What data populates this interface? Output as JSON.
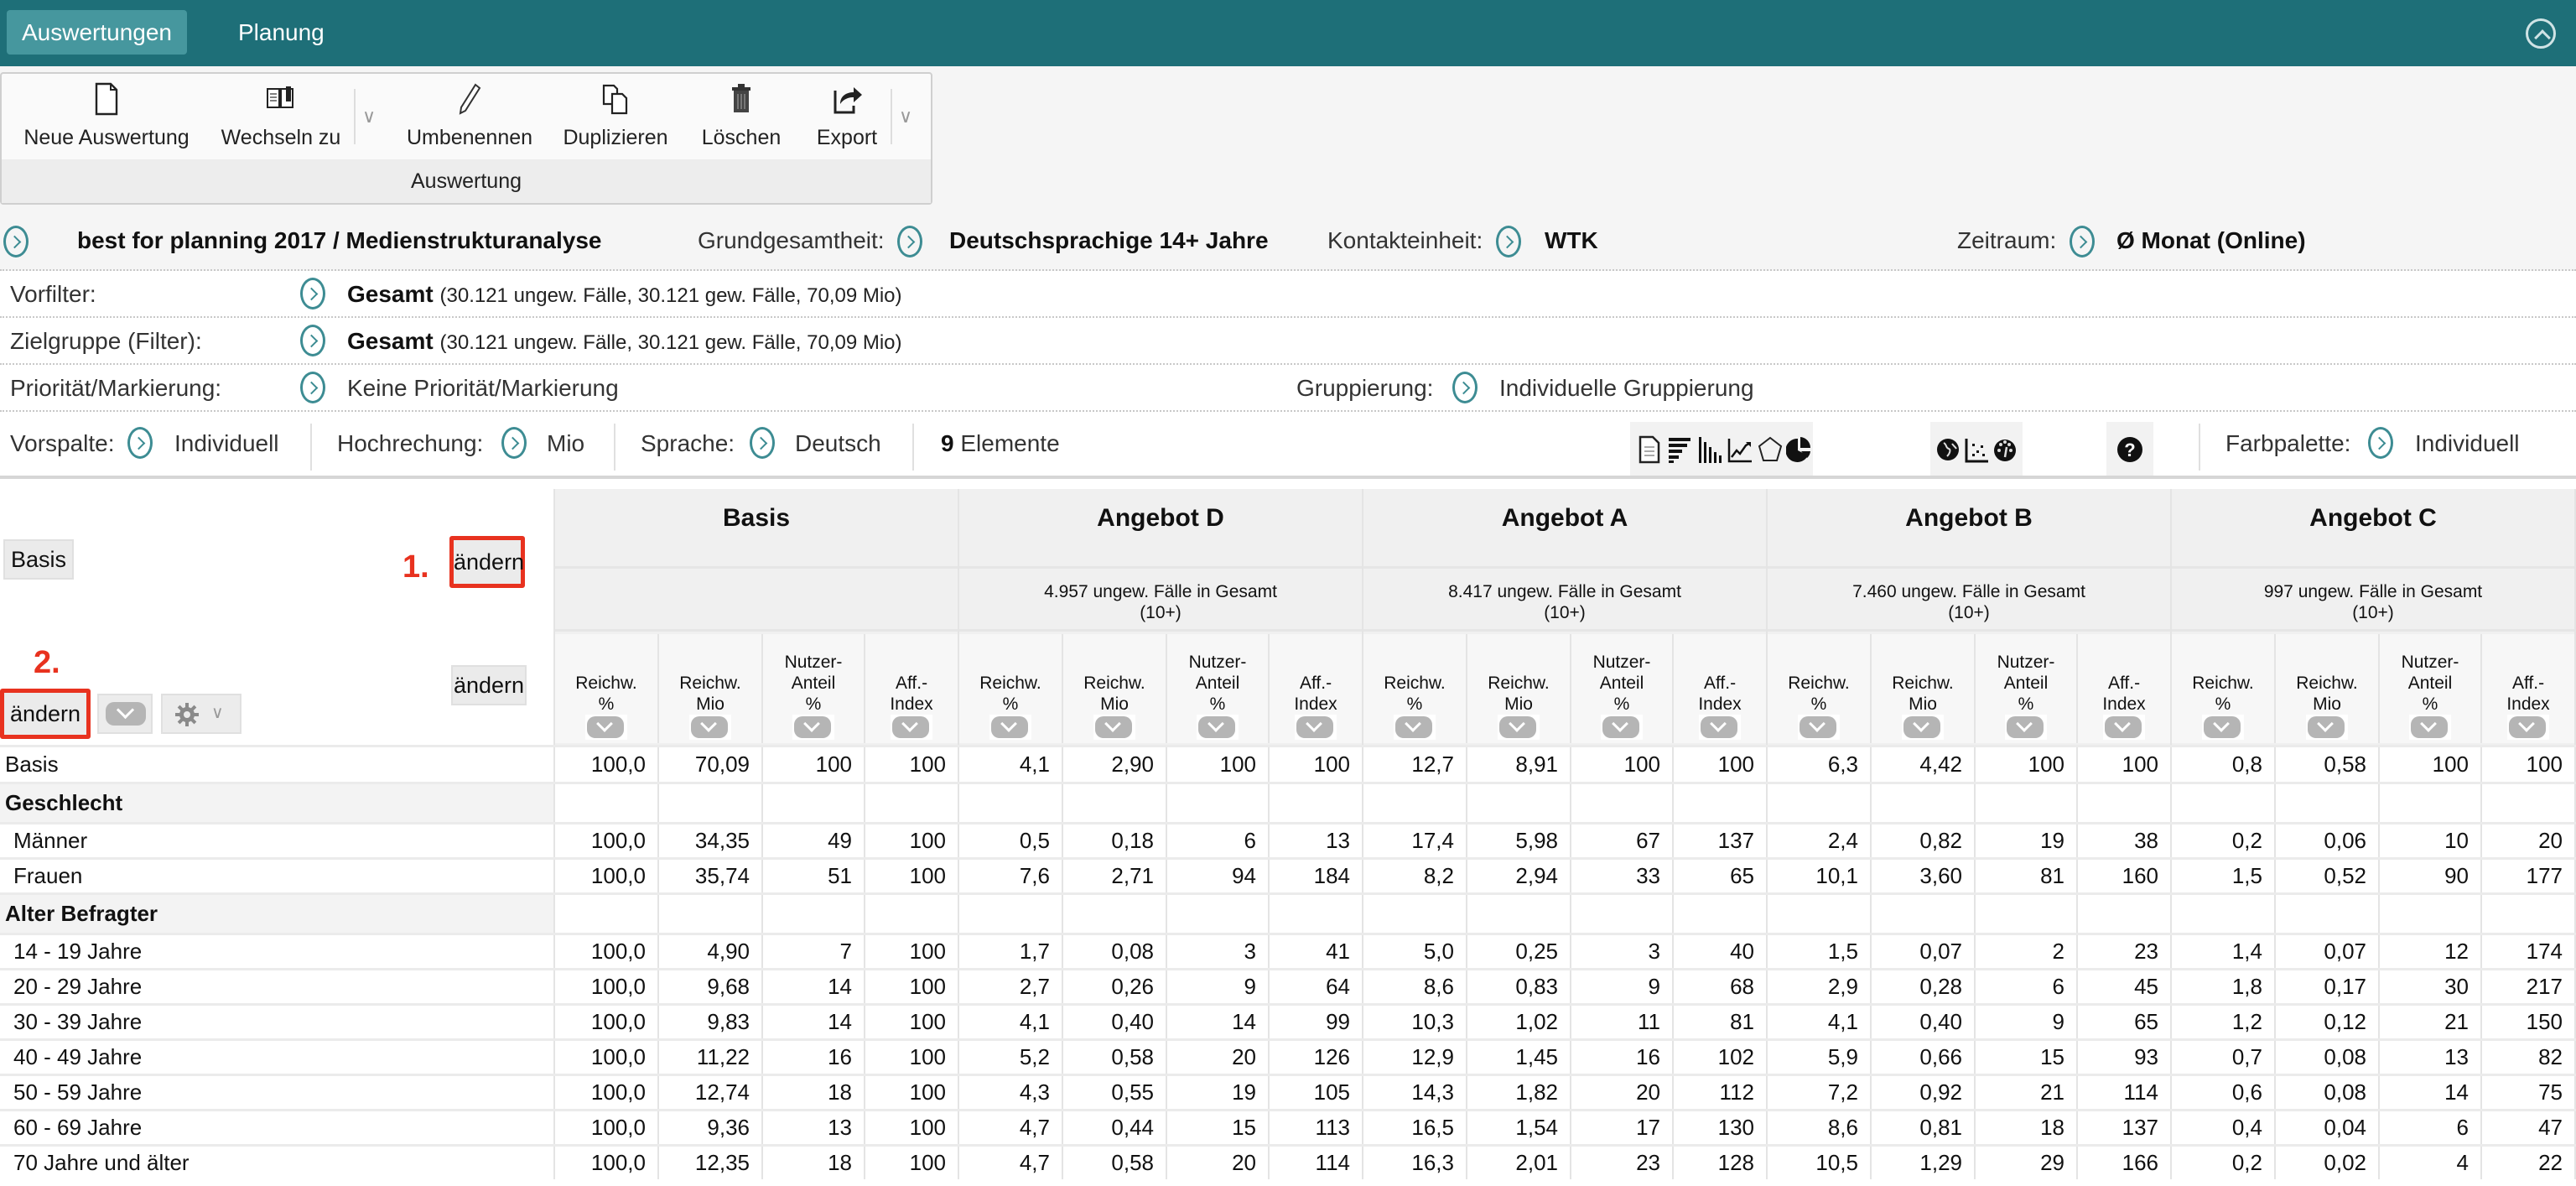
{
  "topbar": {
    "tabs": [
      {
        "label": "Auswertungen",
        "active": true
      },
      {
        "label": "Planung",
        "active": false
      }
    ],
    "collapse_icon": "chevron-up-circle-icon"
  },
  "ribbon": {
    "group_label": "Auswertung",
    "buttons": [
      {
        "label": "Neue Auswertung",
        "icon": "new-document-icon"
      },
      {
        "label": "Wechseln zu",
        "icon": "switch-book-icon"
      },
      {
        "label": "Umbenennen",
        "icon": "pencil-icon"
      },
      {
        "label": "Duplizieren",
        "icon": "duplicate-icon"
      },
      {
        "label": "Löschen",
        "icon": "trash-icon"
      },
      {
        "label": "Export",
        "icon": "export-icon"
      }
    ]
  },
  "study": {
    "title": "best for planning 2017 / Medienstrukturanalyse",
    "grundgesamtheit_label": "Grundgesamtheit:",
    "grundgesamtheit_value": "Deutschsprachige 14+ Jahre",
    "kontakteinheit_label": "Kontakteinheit:",
    "kontakteinheit_value": "WTK",
    "zeitraum_label": "Zeitraum:",
    "zeitraum_value": "Ø Monat (Online)"
  },
  "filters": {
    "vorfilter_label": "Vorfilter:",
    "vorfilter_value": "Gesamt",
    "vorfilter_detail": "(30.121 ungew. Fälle, 30.121 gew. Fälle, 70,09 Mio)",
    "zielgruppe_label": "Zielgruppe (Filter):",
    "zielgruppe_value": "Gesamt",
    "zielgruppe_detail": "(30.121 ungew. Fälle, 30.121 gew. Fälle, 70,09 Mio)",
    "prioritaet_label": "Priorität/Markierung:",
    "prioritaet_value": "Keine Priorität/Markierung",
    "gruppierung_label": "Gruppierung:",
    "gruppierung_value": "Individuelle Gruppierung"
  },
  "options": {
    "vorspalte_label": "Vorspalte:",
    "vorspalte_value": "Individuell",
    "hochrechnung_label": "Hochrechung:",
    "hochrechnung_value": "Mio",
    "sprache_label": "Sprache:",
    "sprache_value": "Deutsch",
    "elemente_count": "9",
    "elemente_label": "Elemente",
    "farbpalette_label": "Farbpalette:",
    "farbpalette_value": "Individuell",
    "view_icons": [
      "table-view-icon",
      "horizontal-bar-chart-icon",
      "vertical-bar-chart-icon",
      "line-chart-icon",
      "radar-chart-icon",
      "pie-chart-icon"
    ],
    "extra_icons": [
      "globe-map-icon",
      "scatter-plot-icon",
      "gauge-icon"
    ],
    "help_icon": "help-icon"
  },
  "table": {
    "corner": {
      "basis_label": "Basis",
      "aendern_label": "ändern",
      "annotation_1": "1.",
      "annotation_2": "2."
    },
    "column_headers": [
      "Reichw.\n%",
      "Reichw.\nMio",
      "Nutzer-\nAnteil\n%",
      "Aff.-\nIndex"
    ],
    "groups": [
      {
        "title": "Basis",
        "subtitle": ""
      },
      {
        "title": "Angebot D",
        "subtitle": "4.957 ungew. Fälle in Gesamt (10+)"
      },
      {
        "title": "Angebot A",
        "subtitle": "8.417 ungew. Fälle in Gesamt (10+)"
      },
      {
        "title": "Angebot B",
        "subtitle": "7.460 ungew. Fälle in Gesamt (10+)"
      },
      {
        "title": "Angebot C",
        "subtitle": "997 ungew. Fälle in Gesamt (10+)"
      }
    ],
    "rows": [
      {
        "label": "Basis",
        "type": "base",
        "values": [
          "100,0",
          "70,09",
          "100",
          "100",
          "4,1",
          "2,90",
          "100",
          "100",
          "12,7",
          "8,91",
          "100",
          "100",
          "6,3",
          "4,42",
          "100",
          "100",
          "0,8",
          "0,58",
          "100",
          "100"
        ]
      },
      {
        "label": "Geschlecht",
        "type": "cat",
        "values": []
      },
      {
        "label": "Männer",
        "type": "sub",
        "values": [
          "100,0",
          "34,35",
          "49",
          "100",
          "0,5",
          "0,18",
          "6",
          "13",
          "17,4",
          "5,98",
          "67",
          "137",
          "2,4",
          "0,82",
          "19",
          "38",
          "0,2",
          "0,06",
          "10",
          "20"
        ]
      },
      {
        "label": "Frauen",
        "type": "sub",
        "values": [
          "100,0",
          "35,74",
          "51",
          "100",
          "7,6",
          "2,71",
          "94",
          "184",
          "8,2",
          "2,94",
          "33",
          "65",
          "10,1",
          "3,60",
          "81",
          "160",
          "1,5",
          "0,52",
          "90",
          "177"
        ]
      },
      {
        "label": "Alter Befragter",
        "type": "cat",
        "values": []
      },
      {
        "label": "14 - 19 Jahre",
        "type": "sub",
        "values": [
          "100,0",
          "4,90",
          "7",
          "100",
          "1,7",
          "0,08",
          "3",
          "41",
          "5,0",
          "0,25",
          "3",
          "40",
          "1,5",
          "0,07",
          "2",
          "23",
          "1,4",
          "0,07",
          "12",
          "174"
        ]
      },
      {
        "label": "20 - 29 Jahre",
        "type": "sub",
        "values": [
          "100,0",
          "9,68",
          "14",
          "100",
          "2,7",
          "0,26",
          "9",
          "64",
          "8,6",
          "0,83",
          "9",
          "68",
          "2,9",
          "0,28",
          "6",
          "45",
          "1,8",
          "0,17",
          "30",
          "217"
        ]
      },
      {
        "label": "30 - 39 Jahre",
        "type": "sub",
        "values": [
          "100,0",
          "9,83",
          "14",
          "100",
          "4,1",
          "0,40",
          "14",
          "99",
          "10,3",
          "1,02",
          "11",
          "81",
          "4,1",
          "0,40",
          "9",
          "65",
          "1,2",
          "0,12",
          "21",
          "150"
        ]
      },
      {
        "label": "40 - 49 Jahre",
        "type": "sub",
        "values": [
          "100,0",
          "11,22",
          "16",
          "100",
          "5,2",
          "0,58",
          "20",
          "126",
          "12,9",
          "1,45",
          "16",
          "102",
          "5,9",
          "0,66",
          "15",
          "93",
          "0,7",
          "0,08",
          "13",
          "82"
        ]
      },
      {
        "label": "50 - 59 Jahre",
        "type": "sub",
        "values": [
          "100,0",
          "12,74",
          "18",
          "100",
          "4,3",
          "0,55",
          "19",
          "105",
          "14,3",
          "1,82",
          "20",
          "112",
          "7,2",
          "0,92",
          "21",
          "114",
          "0,6",
          "0,08",
          "14",
          "75"
        ]
      },
      {
        "label": "60 - 69 Jahre",
        "type": "sub",
        "values": [
          "100,0",
          "9,36",
          "13",
          "100",
          "4,7",
          "0,44",
          "15",
          "113",
          "16,5",
          "1,54",
          "17",
          "130",
          "8,6",
          "0,81",
          "18",
          "137",
          "0,4",
          "0,04",
          "6",
          "47"
        ]
      },
      {
        "label": "70 Jahre und älter",
        "type": "sub",
        "values": [
          "100,0",
          "12,35",
          "18",
          "100",
          "4,7",
          "0,58",
          "20",
          "114",
          "16,3",
          "2,01",
          "23",
          "128",
          "10,5",
          "1,29",
          "29",
          "166",
          "0,2",
          "0,02",
          "4",
          "22"
        ]
      }
    ]
  }
}
